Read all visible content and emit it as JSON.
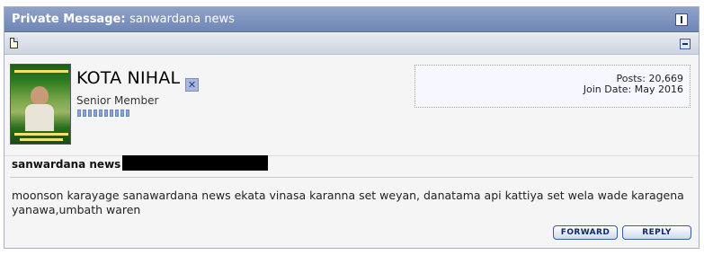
{
  "header": {
    "title_prefix": "Private Message:",
    "subject": "sanwardana news",
    "title_button_icon": "info-icon"
  },
  "subbar": {
    "message_icon": "document-icon",
    "collapse_icon": "collapse-icon"
  },
  "user": {
    "username": "KOTA NIHAL",
    "status_icon": "offline-icon",
    "status_glyph": "✕",
    "title": "Senior Member",
    "reputation_pips": 10,
    "posts_label": "Posts: 20,669",
    "join_label": "Join Date: May 2016"
  },
  "message": {
    "title": "sanwardana news -",
    "body": "moonson karayage sanawardana news ekata vinasa karanna set weyan, danatama api kattiya set wela wade karagena yanawa,umbath waren"
  },
  "buttons": {
    "forward": "FORWARD",
    "reply": "REPLY"
  }
}
